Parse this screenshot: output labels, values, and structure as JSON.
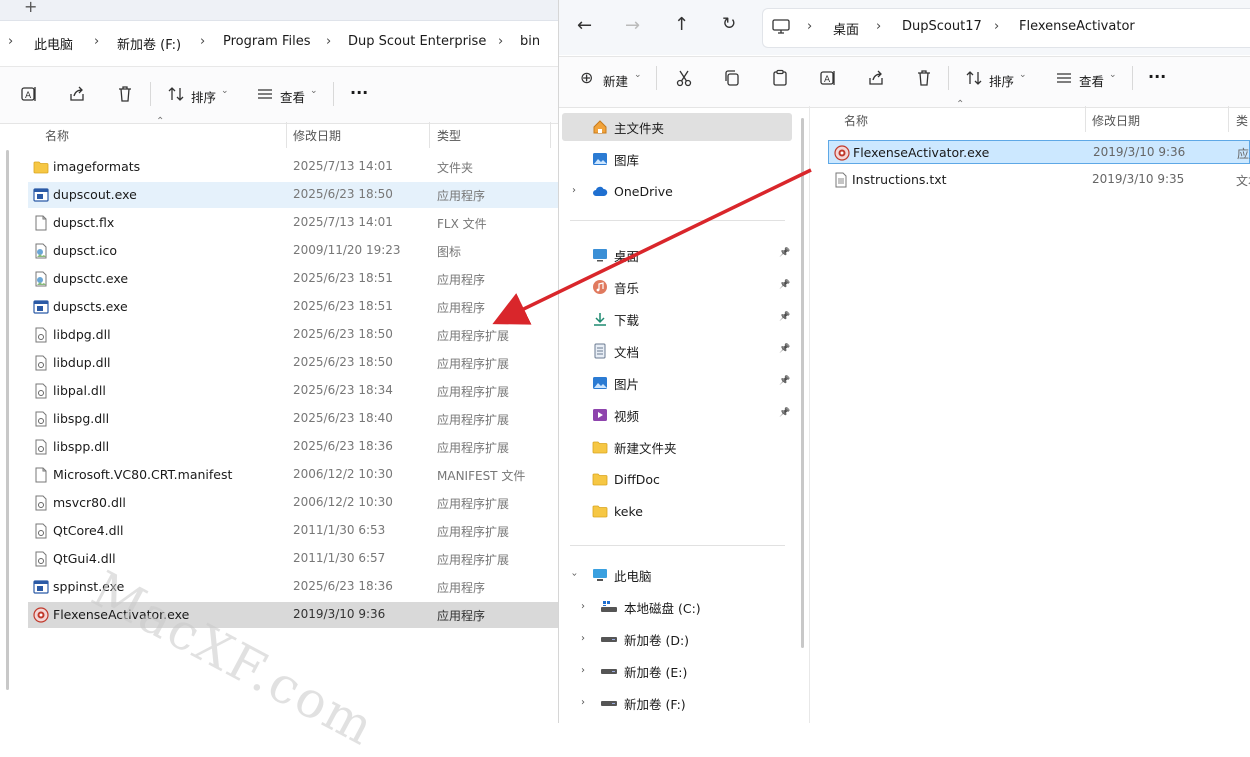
{
  "left": {
    "new_tab_glyph": "+",
    "breadcrumb": [
      "此电脑",
      "新加卷 (F:)",
      "Program Files",
      "Dup Scout Enterprise",
      "bin"
    ],
    "toolbar": {
      "sort_label": "排序",
      "view_label": "查看",
      "more_label": "···"
    },
    "columns": {
      "name": "名称",
      "date": "修改日期",
      "type": "类型"
    },
    "files": [
      {
        "name": "imageformats",
        "date": "2025/7/13 14:01",
        "type": "文件夹",
        "icon": "folder-icon"
      },
      {
        "name": "dupscout.exe",
        "date": "2025/6/23 18:50",
        "type": "应用程序",
        "icon": "app-icon"
      },
      {
        "name": "dupsct.flx",
        "date": "2025/7/13 14:01",
        "type": "FLX 文件",
        "icon": "document-icon"
      },
      {
        "name": "dupsct.ico",
        "date": "2009/11/20 19:23",
        "type": "图标",
        "icon": "image-icon"
      },
      {
        "name": "dupsctc.exe",
        "date": "2025/6/23 18:51",
        "type": "应用程序",
        "icon": "image-icon"
      },
      {
        "name": "dupscts.exe",
        "date": "2025/6/23 18:51",
        "type": "应用程序",
        "icon": "app-icon"
      },
      {
        "name": "libdpg.dll",
        "date": "2025/6/23 18:50",
        "type": "应用程序扩展",
        "icon": "dll-icon"
      },
      {
        "name": "libdup.dll",
        "date": "2025/6/23 18:50",
        "type": "应用程序扩展",
        "icon": "dll-icon"
      },
      {
        "name": "libpal.dll",
        "date": "2025/6/23 18:34",
        "type": "应用程序扩展",
        "icon": "dll-icon"
      },
      {
        "name": "libspg.dll",
        "date": "2025/6/23 18:40",
        "type": "应用程序扩展",
        "icon": "dll-icon"
      },
      {
        "name": "libspp.dll",
        "date": "2025/6/23 18:36",
        "type": "应用程序扩展",
        "icon": "dll-icon"
      },
      {
        "name": "Microsoft.VC80.CRT.manifest",
        "date": "2006/12/2 10:30",
        "type": "MANIFEST 文件",
        "icon": "document-icon"
      },
      {
        "name": "msvcr80.dll",
        "date": "2006/12/2 10:30",
        "type": "应用程序扩展",
        "icon": "dll-icon"
      },
      {
        "name": "QtCore4.dll",
        "date": "2011/1/30 6:53",
        "type": "应用程序扩展",
        "icon": "dll-icon"
      },
      {
        "name": "QtGui4.dll",
        "date": "2011/1/30 6:57",
        "type": "应用程序扩展",
        "icon": "dll-icon"
      },
      {
        "name": "sppinst.exe",
        "date": "2025/6/23 18:36",
        "type": "应用程序",
        "icon": "app-icon"
      },
      {
        "name": "FlexenseActivator.exe",
        "date": "2019/3/10 9:36",
        "type": "应用程序",
        "icon": "activator-icon"
      }
    ]
  },
  "right": {
    "breadcrumb": [
      "桌面",
      "DupScout17",
      "FlexenseActivator"
    ],
    "toolbar": {
      "new_label": "新建",
      "sort_label": "排序",
      "view_label": "查看",
      "more_label": "···"
    },
    "nav": {
      "home": "主文件夹",
      "gallery": "图库",
      "onedrive": "OneDrive",
      "pinned": [
        "桌面",
        "音乐",
        "下载",
        "文档",
        "图片",
        "视频"
      ],
      "folders": [
        "新建文件夹",
        "DiffDoc",
        "keke"
      ],
      "this_pc": "此电脑",
      "drives": [
        "本地磁盘 (C:)",
        "新加卷 (D:)",
        "新加卷 (E:)",
        "新加卷 (F:)"
      ]
    },
    "columns": {
      "name": "名称",
      "date": "修改日期",
      "type": "类"
    },
    "files": [
      {
        "name": "FlexenseActivator.exe",
        "date": "2019/3/10 9:36",
        "type": "应用",
        "icon": "activator-icon"
      },
      {
        "name": "Instructions.txt",
        "date": "2019/3/10 9:35",
        "type": "文本",
        "icon": "text-file-icon"
      }
    ]
  },
  "watermark": "MacXF.com",
  "colors": {
    "arrow": "#d9262b",
    "selection": "#cce8ff",
    "folder": "#f6c744"
  }
}
